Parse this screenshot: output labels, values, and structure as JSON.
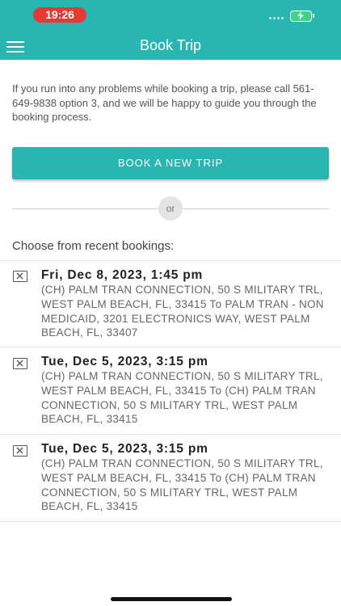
{
  "status_bar": {
    "time": "19:26"
  },
  "header": {
    "title": "Book Trip"
  },
  "info": {
    "text": "If you run into any problems while booking a trip, please call 561-649-9838 option 3, and we will be happy to guide you through the booking process."
  },
  "actions": {
    "book_new_trip": "BOOK A NEW TRIP",
    "or_label": "or"
  },
  "recent": {
    "heading": "Choose from recent bookings:",
    "bookings": [
      {
        "date": "Fri, Dec 8, 2023, 1:45 pm",
        "route": "(CH) PALM TRAN CONNECTION, 50 S MILITARY TRL, WEST PALM BEACH, FL, 33415 To PALM TRAN - NON MEDICAID, 3201 ELECTRONICS WAY, WEST PALM BEACH, FL, 33407"
      },
      {
        "date": "Tue, Dec 5, 2023, 3:15 pm",
        "route": "(CH) PALM TRAN CONNECTION, 50 S MILITARY TRL, WEST PALM BEACH, FL, 33415 To (CH) PALM TRAN CONNECTION, 50 S MILITARY TRL, WEST PALM BEACH, FL, 33415"
      },
      {
        "date": "Tue, Dec 5, 2023, 3:15 pm",
        "route": "(CH) PALM TRAN CONNECTION, 50 S MILITARY TRL, WEST PALM BEACH, FL, 33415 To (CH) PALM TRAN CONNECTION, 50 S MILITARY TRL, WEST PALM BEACH, FL, 33415"
      }
    ]
  },
  "colors": {
    "accent": "#29b6b0",
    "time_pill": "#e53935",
    "battery": "#3fd18a"
  },
  "icons": {
    "menu": "hamburger-icon",
    "remove_booking": "close-box-icon",
    "battery": "battery-charging-icon"
  }
}
